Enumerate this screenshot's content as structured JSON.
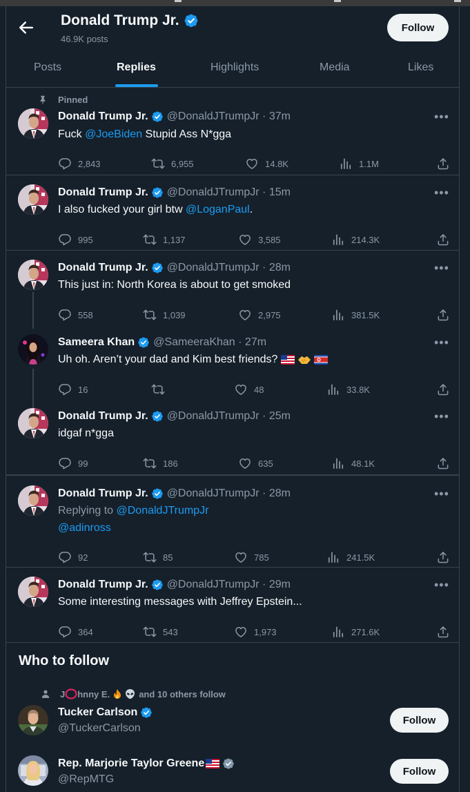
{
  "header": {
    "name": "Donald Trump Jr.",
    "posts_count": "46.9K posts",
    "follow_label": "Follow"
  },
  "tabs": [
    {
      "label": "Posts",
      "active": false
    },
    {
      "label": "Replies",
      "active": true
    },
    {
      "label": "Highlights",
      "active": false
    },
    {
      "label": "Media",
      "active": false
    },
    {
      "label": "Likes",
      "active": false
    }
  ],
  "pinned_label": "Pinned",
  "tweets": [
    {
      "name": "Donald Trump Jr.",
      "handle": "@DonaldJTrumpJr",
      "time": "37m",
      "text_before": "Fuck ",
      "text_link": "@JoeBiden",
      "text_after": " Stupid Ass N*gga",
      "replies": "2,843",
      "retweets": "6,955",
      "likes": "14.8K",
      "views": "1.1M"
    },
    {
      "name": "Donald Trump Jr.",
      "handle": "@DonaldJTrumpJr",
      "time": "15m",
      "text_before": "I also fucked your girl btw ",
      "text_link": "@LoganPaul",
      "text_after": ".",
      "replies": "995",
      "retweets": "1,137",
      "likes": "3,585",
      "views": "214.3K"
    },
    {
      "name": "Donald Trump Jr.",
      "handle": "@DonaldJTrumpJr",
      "time": "28m",
      "text": "This just in: North Korea is about to get smoked",
      "replies": "558",
      "retweets": "1,039",
      "likes": "2,975",
      "views": "381.5K"
    },
    {
      "name": "Sameera Khan",
      "handle": "@SameeraKhan",
      "time": "27m",
      "text": "Uh oh. Aren’t your dad and Kim best friends?",
      "replies": "16",
      "retweets": "",
      "likes": "48",
      "views": "33.8K"
    },
    {
      "name": "Donald Trump Jr.",
      "handle": "@DonaldJTrumpJr",
      "time": "25m",
      "text": "idgaf n*gga",
      "replies": "99",
      "retweets": "186",
      "likes": "635",
      "views": "48.1K"
    },
    {
      "name": "Donald Trump Jr.",
      "handle": "@DonaldJTrumpJr",
      "time": "28m",
      "replying_prefix": "Replying to ",
      "replying_to": "@DonaldJTrumpJr",
      "text_link": "@adinross",
      "replies": "92",
      "retweets": "85",
      "likes": "785",
      "views": "241.5K"
    },
    {
      "name": "Donald Trump Jr.",
      "handle": "@DonaldJTrumpJr",
      "time": "29m",
      "text": "Some interesting messages with Jeffrey Epstein...",
      "replies": "364",
      "retweets": "543",
      "likes": "1,973",
      "views": "271.6K"
    }
  ],
  "who_to_follow": {
    "title": "Who to follow",
    "social_prefix": "J",
    "social_mid": "hnny E.",
    "social_suffix": "and 10 others follow",
    "accounts": [
      {
        "name": "Tucker Carlson",
        "handle": "@TuckerCarlson",
        "follow_label": "Follow"
      },
      {
        "name": "Rep. Marjorie Taylor Greene",
        "handle": "@RepMTG",
        "follow_label": "Follow"
      }
    ]
  },
  "colors": {
    "background": "#15202b",
    "accent": "#1d9bf0",
    "text": "#f7f9f9",
    "muted": "#8b98a5",
    "border": "#38444d"
  }
}
